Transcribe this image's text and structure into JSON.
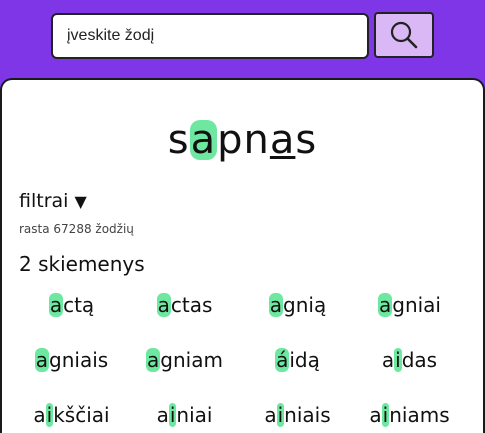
{
  "search": {
    "value": "įveskite žodį"
  },
  "word": {
    "prefix": "s",
    "hl1": "a",
    "mid": "pn",
    "ul": "a",
    "suffix": "s"
  },
  "filters": {
    "label": "filtrai",
    "toggle": "▼"
  },
  "results": {
    "count_text": "rasta 67288 žodžių",
    "syllables_label": "2 skiemenys"
  },
  "words": [
    {
      "pre": "",
      "hl": "a",
      "post": "ctą"
    },
    {
      "pre": "",
      "hl": "a",
      "post": "ctas"
    },
    {
      "pre": "",
      "hl": "a",
      "post": "gnią"
    },
    {
      "pre": "",
      "hl": "a",
      "post": "gniai"
    },
    {
      "pre": "",
      "hl": "a",
      "post": "gniais"
    },
    {
      "pre": "",
      "hl": "a",
      "post": "gniam"
    },
    {
      "pre": "",
      "hl": "á",
      "post": "idą"
    },
    {
      "pre": "a",
      "hl": "i",
      "post": "das"
    },
    {
      "pre": "a",
      "hl": "i",
      "post": "kščiai"
    },
    {
      "pre": "a",
      "hl": "i",
      "post": "niai"
    },
    {
      "pre": "a",
      "hl": "i",
      "post": "niais"
    },
    {
      "pre": "a",
      "hl": "i",
      "post": "niams"
    }
  ]
}
